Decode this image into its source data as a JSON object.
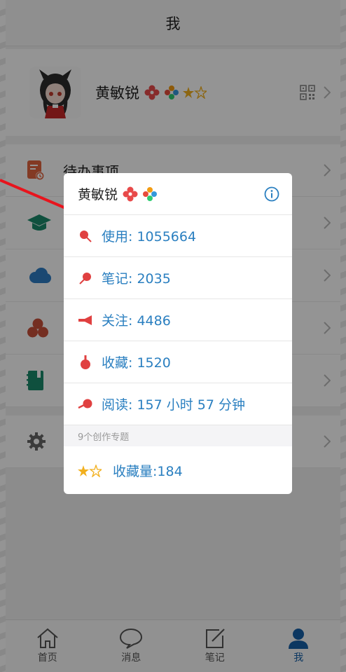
{
  "header": {
    "title": "我"
  },
  "profile": {
    "name": "黄敏锐"
  },
  "menu": {
    "todo_label": "待办事项"
  },
  "popup": {
    "name": "黄敏锐",
    "stats": [
      {
        "text": "使用: 1055664",
        "icon": "pushpin-icon",
        "color": "#e04040"
      },
      {
        "text": "笔记: 2035",
        "icon": "pin-tilted-icon",
        "color": "#e04040"
      },
      {
        "text": "关注: 4486",
        "icon": "horn-icon",
        "color": "#e04040"
      },
      {
        "text": "收藏: 1520",
        "icon": "drop-bulb-icon",
        "color": "#e04040"
      },
      {
        "text": "阅读: 157 小时 57 分钟",
        "icon": "trumpet-icon",
        "color": "#e04040"
      }
    ],
    "topics_label": "9个创作专题",
    "favorites_text": "收藏量:184"
  },
  "tabs": [
    {
      "label": "首页",
      "icon": "home-icon"
    },
    {
      "label": "消息",
      "icon": "chat-bubble-icon"
    },
    {
      "label": "笔记",
      "icon": "edit-note-icon"
    },
    {
      "label": "我",
      "icon": "person-icon",
      "active": true
    }
  ],
  "colors": {
    "accent": "#2a7fc0",
    "tab_active": "#1560a8",
    "arrow": "#e8141d"
  }
}
